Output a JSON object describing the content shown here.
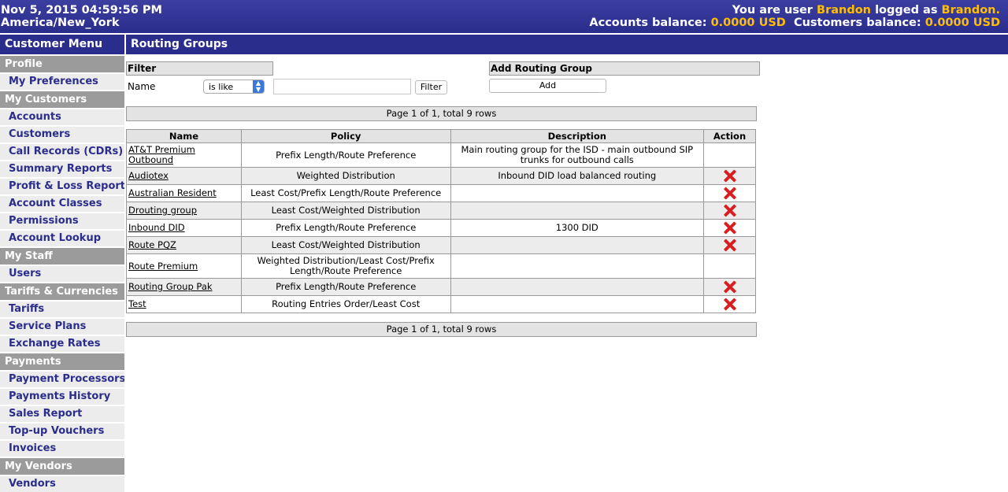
{
  "header": {
    "datetime": "Nov 5, 2015 04:59:56 PM",
    "timezone": "America/New_York",
    "user_prefix": "You are user",
    "user": "Brandon",
    "logged_as": "logged as",
    "login": "Brandon.",
    "accounts_balance_label": "Accounts balance:",
    "accounts_balance": "0.0000 USD",
    "customers_balance_label": "Customers balance:",
    "customers_balance": "0.0000 USD"
  },
  "sidebar": {
    "title": "Customer Menu",
    "sections": [
      {
        "title": "Profile",
        "items": [
          "My Preferences"
        ]
      },
      {
        "title": "My Customers",
        "items": [
          "Accounts",
          "Customers",
          "Call Records (CDRs)",
          "Summary Reports",
          "Profit & Loss Report",
          "Account Classes",
          "Permissions",
          "Account Lookup"
        ]
      },
      {
        "title": "My Staff",
        "items": [
          "Users"
        ]
      },
      {
        "title": "Tariffs & Currencies",
        "items": [
          "Tariffs",
          "Service Plans",
          "Exchange Rates"
        ]
      },
      {
        "title": "Payments",
        "items": [
          "Payment Processors",
          "Payments History",
          "Sales Report",
          "Top-up Vouchers",
          "Invoices"
        ]
      },
      {
        "title": "My Vendors",
        "items": [
          "Vendors"
        ]
      }
    ]
  },
  "main": {
    "title": "Routing Groups",
    "filter": {
      "header": "Filter",
      "name_label": "Name",
      "operator": "is like",
      "value": "",
      "button": "Filter"
    },
    "add": {
      "header": "Add Routing Group",
      "button": "Add"
    },
    "pager_text": "Page 1 of 1, total 9 rows",
    "table": {
      "columns": [
        "Name",
        "Policy",
        "Description",
        "Action"
      ],
      "rows": [
        {
          "name": "AT&T Premium Outbound",
          "policy": "Prefix Length/Route Preference",
          "description": "Main routing group for the ISD - main outbound SIP trunks for outbound calls",
          "deletable": false
        },
        {
          "name": "Audiotex",
          "policy": "Weighted Distribution",
          "description": "Inbound DID load balanced routing",
          "deletable": true
        },
        {
          "name": "Australian Resident",
          "policy": "Least Cost/Prefix Length/Route Preference",
          "description": "",
          "deletable": true
        },
        {
          "name": "Drouting group",
          "policy": "Least Cost/Weighted Distribution",
          "description": "",
          "deletable": true
        },
        {
          "name": "Inbound DID",
          "policy": "Prefix Length/Route Preference",
          "description": "1300 DID",
          "deletable": true
        },
        {
          "name": "Route PQZ",
          "policy": "Least Cost/Weighted Distribution",
          "description": "",
          "deletable": true
        },
        {
          "name": "Route Premium",
          "policy": "Weighted Distribution/Least Cost/Prefix Length/Route Preference",
          "description": "",
          "deletable": false
        },
        {
          "name": "Routing Group Pak",
          "policy": "Prefix Length/Route Preference",
          "description": "",
          "deletable": true
        },
        {
          "name": "Test",
          "policy": "Routing Entries Order/Least Cost",
          "description": "",
          "deletable": true
        }
      ]
    }
  },
  "colors": {
    "brand": "#2b2d8c",
    "highlight": "#ffbf00",
    "section": "#9b9b9b",
    "delete": "#d81e1e"
  }
}
